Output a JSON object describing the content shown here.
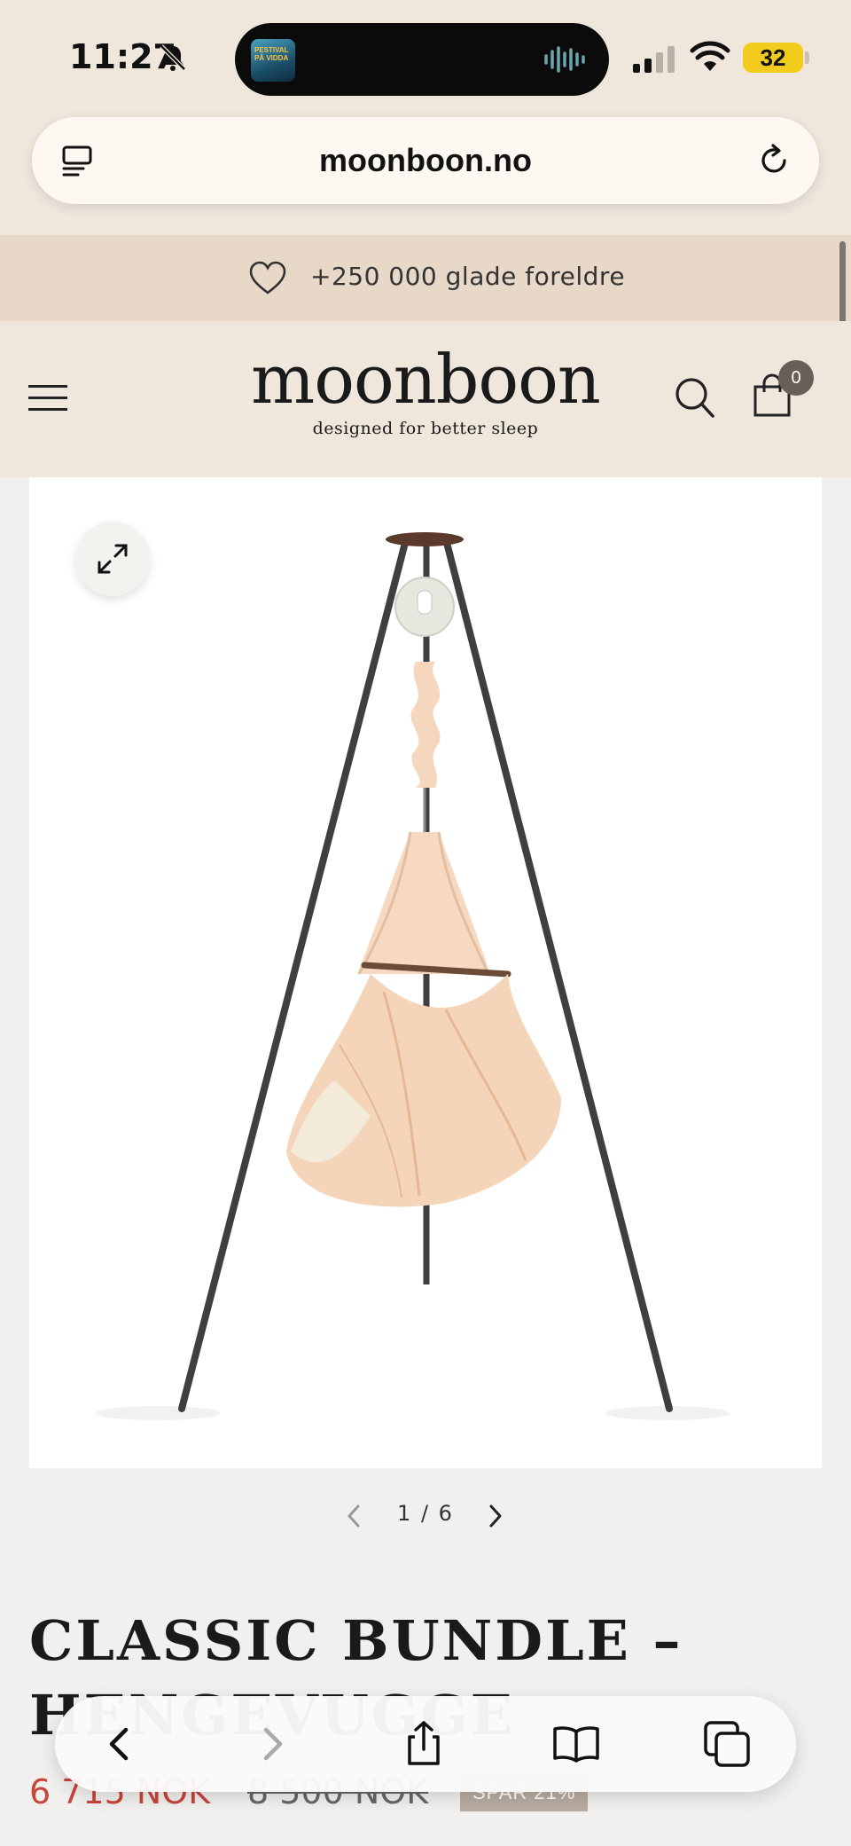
{
  "status_bar": {
    "time": "11:27",
    "battery": "32",
    "now_playing_art_text": "PESTIVAL\nPÅ VIDDA"
  },
  "browser": {
    "url": "moonboon.no"
  },
  "promo": {
    "text": "+250 000 glade foreldre"
  },
  "header": {
    "logo": "moonboon",
    "tagline": "designed for better sleep",
    "cart_count": "0"
  },
  "gallery": {
    "current": "1",
    "separator": "/",
    "total": "6",
    "pager_text": "1 / 6"
  },
  "product": {
    "title": "CLASSIC BUNDLE – HENGEVUGGE",
    "price_sale": "6 715 NOK",
    "price_original": "8 500 NOK",
    "savings_badge": "SPAR 21%"
  },
  "colors": {
    "header_bg": "#efe6dc",
    "promo_bg": "#e7d8c8",
    "sale_red": "#c9443a",
    "badge_bg": "#b8aca2"
  },
  "icons": [
    "bell-slash-icon",
    "signal-icon",
    "wifi-icon",
    "tabs-overview-icon",
    "reload-icon",
    "heart-icon",
    "menu-icon",
    "search-icon",
    "shopping-bag-icon",
    "expand-icon",
    "chevron-left-icon",
    "chevron-right-icon",
    "share-icon",
    "bookmarks-icon",
    "tabs-icon"
  ]
}
